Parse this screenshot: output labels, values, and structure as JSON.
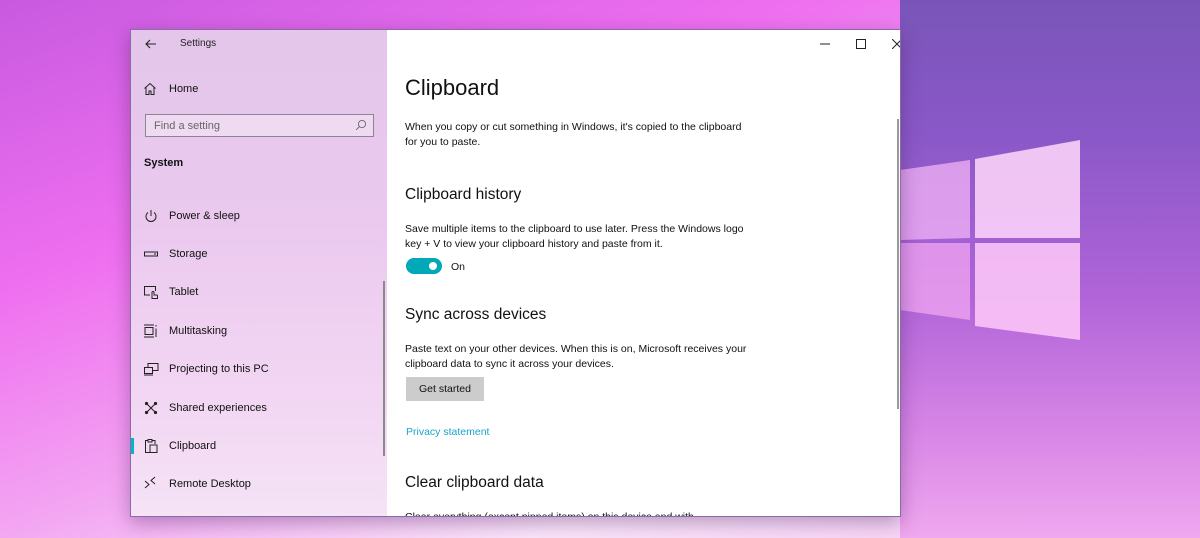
{
  "desktop": {
    "wallpaper_colors": {
      "left": "#ef6ff0",
      "right_top": "#7a55b8",
      "bottom": "#f6c7f4"
    }
  },
  "window": {
    "title": "Settings",
    "back_icon": "arrow-left-icon",
    "controls": {
      "minimize_icon": "minimize-icon",
      "maximize_icon": "maximize-icon",
      "close_icon": "close-icon"
    }
  },
  "sidebar": {
    "home": {
      "label": "Home",
      "icon": "home-icon"
    },
    "search": {
      "placeholder": "Find a setting",
      "value": "",
      "icon": "search-icon"
    },
    "section_label": "System",
    "items": [
      {
        "label": "Power & sleep",
        "icon": "power-icon",
        "active": false
      },
      {
        "label": "Storage",
        "icon": "storage-icon",
        "active": false
      },
      {
        "label": "Tablet",
        "icon": "tablet-icon",
        "active": false
      },
      {
        "label": "Multitasking",
        "icon": "multitasking-icon",
        "active": false
      },
      {
        "label": "Projecting to this PC",
        "icon": "projecting-icon",
        "active": false
      },
      {
        "label": "Shared experiences",
        "icon": "shared-experiences-icon",
        "active": false
      },
      {
        "label": "Clipboard",
        "icon": "clipboard-icon",
        "active": true
      },
      {
        "label": "Remote Desktop",
        "icon": "remote-desktop-icon",
        "active": false
      }
    ],
    "accent_color": "#00b7c3"
  },
  "main": {
    "title": "Clipboard",
    "intro": "When you copy or cut something in Windows, it's copied to the clipboard for you to paste.",
    "sections": {
      "history": {
        "heading": "Clipboard history",
        "description": "Save multiple items to the clipboard to use later. Press the Windows logo key + V to view your clipboard history and paste from it.",
        "toggle_state": "On",
        "toggle_on": true,
        "toggle_color": "#00a8b8"
      },
      "sync": {
        "heading": "Sync across devices",
        "description": "Paste text on your other devices. When this is on, Microsoft receives your clipboard data to sync it across your devices.",
        "button_label": "Get started"
      },
      "privacy_link": "Privacy statement",
      "clear": {
        "heading": "Clear clipboard data",
        "description_partial": "Clear everything (except pinned items) on this device and with"
      }
    },
    "link_color": "#1aa5c8"
  }
}
